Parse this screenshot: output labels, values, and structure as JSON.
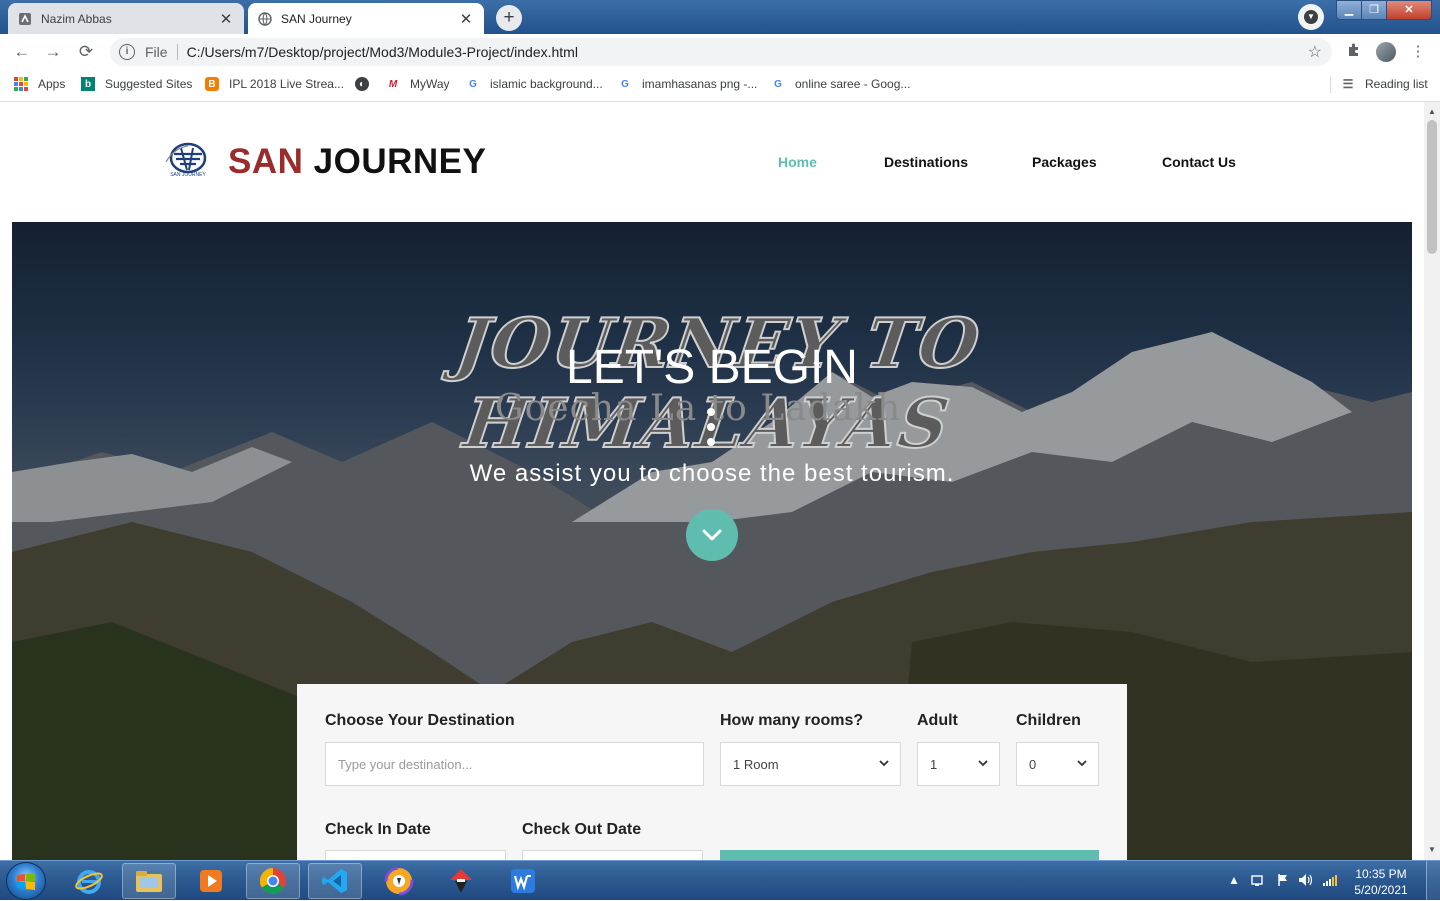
{
  "browser": {
    "tabs": [
      {
        "title": "Nazim Abbas",
        "active": false
      },
      {
        "title": "SAN Journey",
        "active": true
      }
    ],
    "address": {
      "scheme_label": "File",
      "url": "C:/Users/m7/Desktop/project/Mod3/Module3-Project/index.html"
    },
    "bookmarks": [
      {
        "label": "Apps",
        "icon": "apps-grid-icon"
      },
      {
        "label": "Suggested Sites",
        "icon": "bing-icon"
      },
      {
        "label": "IPL 2018 Live Strea...",
        "icon": "blogger-icon"
      },
      {
        "label": "",
        "icon": "globe-icon"
      },
      {
        "label": "MyWay",
        "icon": "myway-icon"
      },
      {
        "label": "islamic background...",
        "icon": "google-icon"
      },
      {
        "label": "imamhasanas png -...",
        "icon": "google-icon"
      },
      {
        "label": "online saree - Goog...",
        "icon": "google-icon"
      }
    ],
    "reading_list": "Reading list"
  },
  "site": {
    "brand": {
      "part1": "SAN",
      "part2": "JOURNEY",
      "logo_caption": "SAN JOURNEY"
    },
    "nav": [
      {
        "label": "Home",
        "active": true
      },
      {
        "label": "Destinations",
        "active": false
      },
      {
        "label": "Packages",
        "active": false
      },
      {
        "label": "Contact Us",
        "active": false
      }
    ],
    "hero": {
      "background_title": "JOURNEY TO HIMALAYAS",
      "background_subtitle": "Goecha La to Ladakh",
      "title": "LET'S BEGIN",
      "subtitle": "We assist you to choose the best tourism."
    },
    "booking": {
      "destination_label": "Choose Your Destination",
      "destination_placeholder": "Type your destination...",
      "rooms_label": "How many rooms?",
      "rooms_value": "1 Room",
      "adult_label": "Adult",
      "adult_value": "1",
      "children_label": "Children",
      "children_value": "0",
      "checkin_label": "Check In Date",
      "checkout_label": "Check Out Date"
    }
  },
  "colors": {
    "accent": "#5fbdb0",
    "brand_red": "#9b2c2c"
  },
  "taskbar": {
    "apps": [
      "internet-explorer-icon",
      "file-explorer-icon",
      "media-player-icon",
      "chrome-icon",
      "vscode-icon",
      "browser-app-icon",
      "download-app-icon",
      "wps-writer-icon"
    ],
    "clock": {
      "time": "10:35 PM",
      "date": "5/20/2021"
    }
  }
}
